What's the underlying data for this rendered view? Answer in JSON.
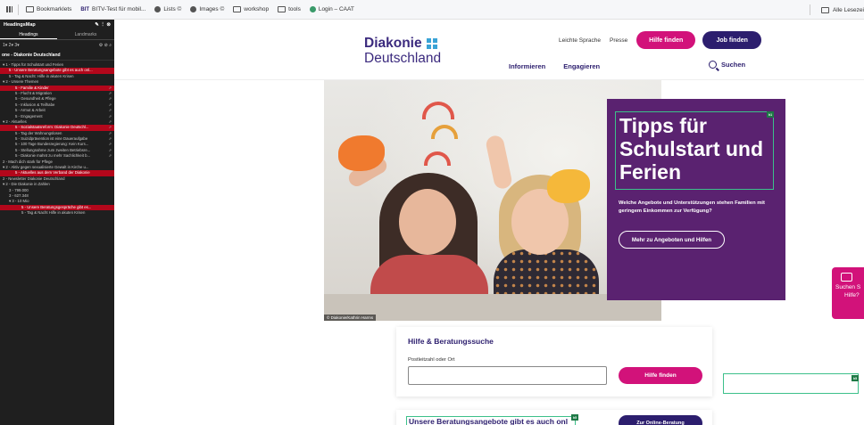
{
  "bookmarks": {
    "items": [
      {
        "label": "Bookmarklets",
        "icon": "folder-icon"
      },
      {
        "label": "BITV-Test für mobil...",
        "icon": "bitv-icon"
      },
      {
        "label": "Lists ©",
        "icon": "globe-icon"
      },
      {
        "label": "Images ©",
        "icon": "globe-icon"
      },
      {
        "label": "workshop",
        "icon": "folder-icon"
      },
      {
        "label": "tools",
        "icon": "folder-icon"
      },
      {
        "label": "Login – CAAT",
        "icon": "globe-icon"
      }
    ],
    "bitv_mark": "BIT",
    "right_label": "Alle Lesezei"
  },
  "headingsmap": {
    "title": "HeadingsMap",
    "tabs": [
      "Headings",
      "Landmarks"
    ],
    "levels": "1▾ 2▾ 3▾",
    "page_title": "one - Diakonie Deutschland",
    "rows": [
      {
        "text": "▾ 1 - Tipps für Schulstart und Ferien",
        "indent": 0,
        "error": false,
        "pin": ""
      },
      {
        "text": "5 - Unsere Beratungsangebote gibt es auch onl...",
        "indent": 1,
        "error": true,
        "pin": ""
      },
      {
        "text": "5 - Tag & Nacht: Hilfe in akuten Krisen",
        "indent": 1,
        "error": false,
        "pin": ""
      },
      {
        "text": "▾ 2 - Unsere Themen",
        "indent": 0,
        "error": false,
        "pin": ""
      },
      {
        "text": "5 - Familie & Kinder",
        "indent": 2,
        "error": true,
        "pin": "⇗"
      },
      {
        "text": "5 - Flucht & Migration",
        "indent": 2,
        "error": false,
        "pin": "⇗"
      },
      {
        "text": "5 - Gesundheit & Pflege",
        "indent": 2,
        "error": false,
        "pin": "⇗"
      },
      {
        "text": "5 - Inklusion & Teilhabe",
        "indent": 2,
        "error": false,
        "pin": "⇗"
      },
      {
        "text": "5 - Armut & Arbeit",
        "indent": 2,
        "error": false,
        "pin": "⇗"
      },
      {
        "text": "5 - Engagement",
        "indent": 2,
        "error": false,
        "pin": "⇗"
      },
      {
        "text": "▾ 2 - Aktuelles",
        "indent": 0,
        "error": false,
        "pin": "⇗"
      },
      {
        "text": "5 - Sozialstaatsreform: Diakonie Deutschl...",
        "indent": 2,
        "error": true,
        "pin": "⇗"
      },
      {
        "text": "5 - Tag der Wohnungslosen",
        "indent": 2,
        "error": false,
        "pin": "⇗"
      },
      {
        "text": "5 - Suizidprävention ist eine Daueraufgabe",
        "indent": 2,
        "error": false,
        "pin": "⇗"
      },
      {
        "text": "5 - 100 Tage Bundesregierung: Kein Kurs...",
        "indent": 2,
        "error": false,
        "pin": "⇗"
      },
      {
        "text": "5 - Stellungnahme zum zweiten Betriebsre...",
        "indent": 2,
        "error": false,
        "pin": "⇗"
      },
      {
        "text": "5 - Diakonie mahnt zu mehr Sachlichkeit b...",
        "indent": 2,
        "error": false,
        "pin": "⇗"
      },
      {
        "text": "2 - Mach dich stark für Pflege",
        "indent": 0,
        "error": false,
        "pin": ""
      },
      {
        "text": "▾ 2 - Aktiv gegen sexualisierte Gewalt in Kirche u...",
        "indent": 0,
        "error": false,
        "pin": ""
      },
      {
        "text": "5 - Aktuelles aus dem Verband der Diakonie",
        "indent": 2,
        "error": true,
        "pin": ""
      },
      {
        "text": "2 - Newsletter Diakonie Deutschland",
        "indent": 0,
        "error": false,
        "pin": ""
      },
      {
        "text": "▾ 2 - Die Diakonie in Zahlen",
        "indent": 0,
        "error": false,
        "pin": ""
      },
      {
        "text": "3 - 799.000",
        "indent": 1,
        "error": false,
        "pin": ""
      },
      {
        "text": "3 - 627.348",
        "indent": 1,
        "error": false,
        "pin": ""
      },
      {
        "text": "▾ 3 - 10 Mio",
        "indent": 1,
        "error": false,
        "pin": ""
      },
      {
        "text": "5 - Unsere Beratungsgespräche gibt es...",
        "indent": 3,
        "error": true,
        "pin": ""
      },
      {
        "text": "5 - Tag & Nacht Hilfe in akuten Krisen",
        "indent": 3,
        "error": false,
        "pin": ""
      }
    ]
  },
  "site": {
    "logo_line1": "Diakonie",
    "logo_line2": "Deutschland",
    "top_links": [
      "Leichte Sprache",
      "Presse"
    ],
    "btn_hilfe": "Hilfe finden",
    "btn_job": "Job finden",
    "nav": [
      "Informieren",
      "Engagieren"
    ],
    "search_label": "Suchen",
    "hero": {
      "title": "Tipps für Schulstart und Ferien",
      "badge": "h1",
      "text": "Welche Angebote und Unterstützungen stehen Familien mit geringem Einkommen zur Verfügung?",
      "button": "Mehr zu Angeboten und Hilfen",
      "credit": "© Diakonie/Kathrin Harms"
    },
    "suche_tab": {
      "line1": "Suchen S",
      "line2": "Hilfe?"
    },
    "card": {
      "title": "Hilfe & Beratungssuche",
      "label": "Postleitzahl oder Ort",
      "button": "Hilfe finden"
    },
    "ghost_badge": "h5",
    "bottom": {
      "title": "Unsere Beratungsangebote gibt es auch onl",
      "badge": "h5",
      "button": "Zur Online-Beratung"
    }
  }
}
